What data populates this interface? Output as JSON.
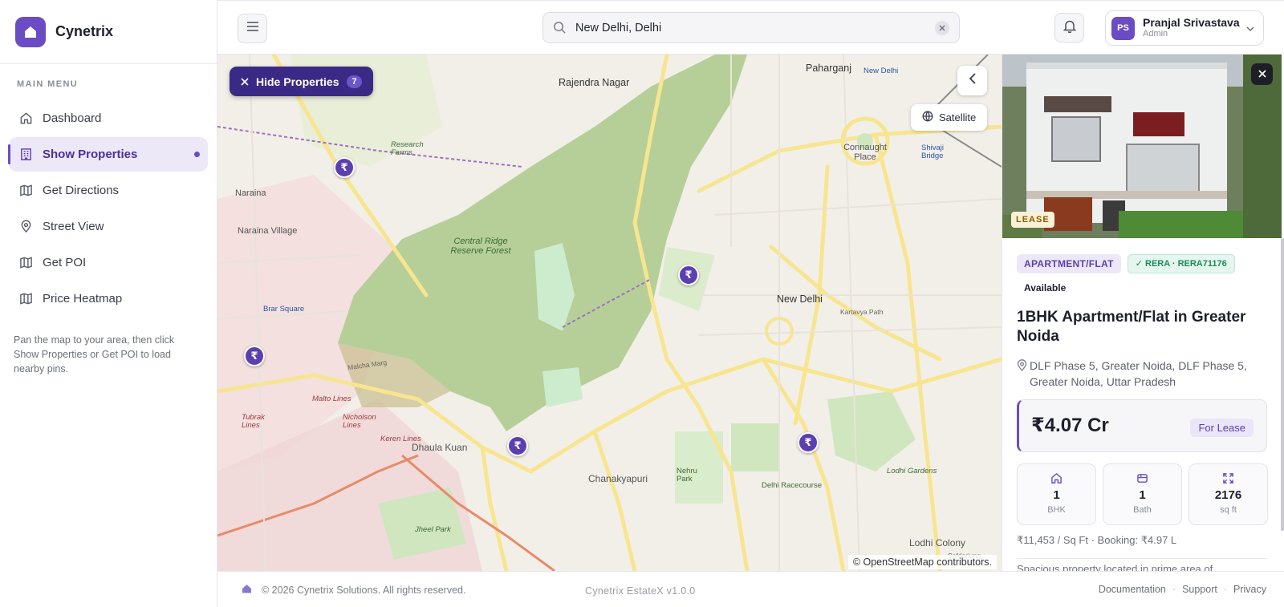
{
  "brand": {
    "name": "Cynetrix"
  },
  "sidebar": {
    "caption": "MAIN MENU",
    "items": [
      {
        "label": "Dashboard",
        "icon": "home-icon"
      },
      {
        "label": "Show Properties",
        "icon": "building-icon",
        "active": true
      },
      {
        "label": "Get Directions",
        "icon": "map-icon"
      },
      {
        "label": "Street View",
        "icon": "location-pin-icon"
      },
      {
        "label": "Get POI",
        "icon": "map-icon"
      },
      {
        "label": "Price Heatmap",
        "icon": "map-icon"
      }
    ],
    "hint": "Pan the map to your area, then click Show Properties or Get POI to load nearby pins."
  },
  "topbar": {
    "search_value": "New Delhi, Delhi",
    "user": {
      "name": "Pranjal Srivastava",
      "role": "Admin",
      "initials": "PS"
    }
  },
  "map": {
    "hide_button": {
      "label": "Hide Properties",
      "count": "7"
    },
    "satellite_label": "Satellite",
    "attribution": "© OpenStreetMap contributors.",
    "labels": {
      "rajendra_nagar": "Rajendra Nagar",
      "paharganj": "Paharganj",
      "new_delhi": "New Delhi",
      "connaught": "Connaught Place",
      "naraina": "Naraina",
      "naraina_village": "Naraina Village",
      "brar_square": "Brar Square",
      "central_ridge": "Central Ridge Reserve Forest",
      "dhaula_kuan": "Dhaula Kuan",
      "chanakyapuri": "Chanakyapuri",
      "lodhi_colony": "Lodhi Colony",
      "malcha_marg": "Malcha Marg",
      "malto_lines": "Malto Lines",
      "nicholson_lines": "Nicholson Lines",
      "keren_lines": "Keren Lines",
      "tubrak_lines": "Tubrak Lines",
      "delhi_racecourse": "Delhi Racecourse",
      "lodhi_gardens": "Lodhi Gardens",
      "research_farms": "Research Farms",
      "shivaji_bridge": "Shivaji Bridge",
      "nehru_park": "Nehru Park",
      "jheel_park": "Jheel Park",
      "kartavya_path": "Kartavya Path",
      "new_delhi_station": "New Delhi",
      "safdarjung": "Safdarjung"
    }
  },
  "panel": {
    "badge": "LEASE",
    "type_tag": "APARTMENT/FLAT",
    "rera_tag": "RERA · RERA71176",
    "availability": "Available",
    "title": "1BHK Apartment/Flat in Greater Noida",
    "address": "DLF Phase 5, Greater Noida, DLF Phase 5, Greater Noida, Uttar Pradesh",
    "price": "₹4.07 Cr",
    "price_tag": "For Lease",
    "stats": [
      {
        "value": "1",
        "label": "BHK",
        "icon": "home-icon"
      },
      {
        "value": "1",
        "label": "Bath",
        "icon": "bath-icon"
      },
      {
        "value": "2176",
        "label": "sq ft",
        "icon": "expand-icon"
      }
    ],
    "rate_line": "₹11,453 / Sq Ft · Booking: ₹4.97 L",
    "description": "Spacious property located in prime area of"
  },
  "footer": {
    "copyright": "© 2026 Cynetrix Solutions. All rights reserved.",
    "version": "Cynetrix EstateX  v1.0.0",
    "links": [
      "Documentation",
      "Support",
      "Privacy"
    ]
  },
  "colors": {
    "accent": "#6b4cc4",
    "accent_dark": "#3a2a86",
    "forest": "#b5cf97",
    "success": "#1f8a5a"
  }
}
